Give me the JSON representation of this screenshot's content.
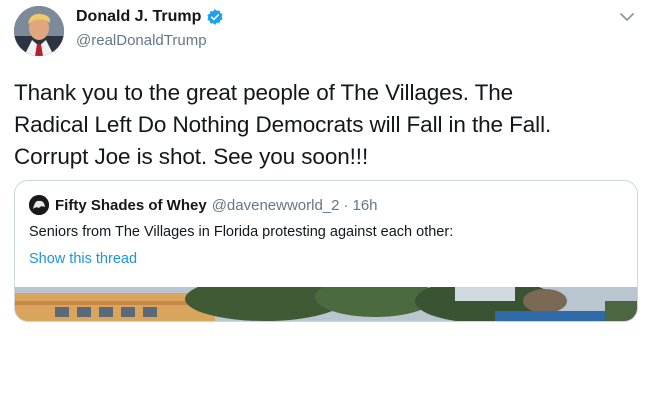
{
  "author": {
    "name": "Donald J. Trump",
    "handle": "@realDonaldTrump",
    "verified": true,
    "verified_color": "#1da1f2"
  },
  "tweet": {
    "lines": [
      "Thank you to the great people of The Villages. The",
      "Radical Left Do Nothing Democrats will Fall in the Fall.",
      "Corrupt Joe is shot. See you soon!!!"
    ]
  },
  "quoted_tweet": {
    "name": "Fifty Shades of Whey",
    "handle": "@davenewworld_2",
    "separator": "·",
    "time": "16h",
    "text": "Seniors from The Villages in Florida protesting against each other:",
    "thread_link": "Show this thread",
    "link_color": "#1b95e0"
  },
  "icons": {
    "menu": "chevron-down-icon",
    "verified": "verified-badge-icon"
  }
}
